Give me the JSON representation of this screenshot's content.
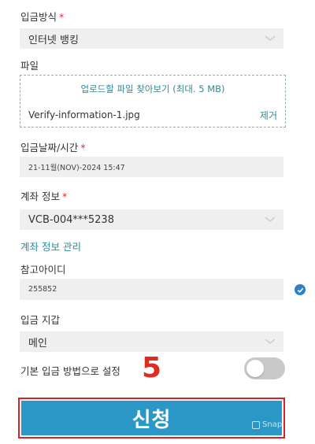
{
  "deposit_method": {
    "label": "입금방식",
    "required_mark": "*",
    "value": "인터넷 뱅킹"
  },
  "file": {
    "label": "파일",
    "upload_text": "업로드할 파일 찾아보기 (최대. 5 MB)",
    "filename": "Verify-information-1.jpg",
    "remove_label": "제거"
  },
  "deposit_datetime": {
    "label": "입금날짜/시간",
    "required_mark": "*",
    "value": "21-11월(NOV)-2024 15:47"
  },
  "account_info": {
    "label": "계좌 정보",
    "required_mark": "*",
    "value": "VCB-004***5238",
    "manage_link": "계좌 정보 관리"
  },
  "reference_id": {
    "label": "참고아이디",
    "value": "255852"
  },
  "deposit_branch": {
    "label": "입금 지갑",
    "value": "메인"
  },
  "default_method": {
    "label": "기본 입금 방법으로 설정",
    "enabled": false
  },
  "annotation": {
    "step_number": "5"
  },
  "submit": {
    "label": "신청"
  },
  "watermark": {
    "text": "Snap"
  },
  "colors": {
    "accent": "#2b97c7",
    "link": "#2e8a96",
    "required": "#e0243a",
    "highlight": "#d3242a"
  }
}
